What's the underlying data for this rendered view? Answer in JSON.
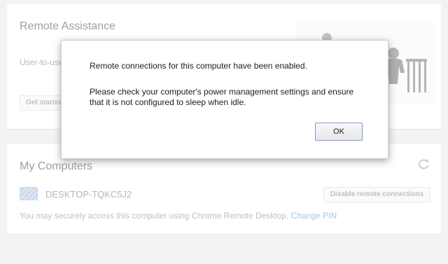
{
  "remote_assistance": {
    "title": "Remote Assistance",
    "description": "User-to-use",
    "get_started_label": "Get started"
  },
  "my_computers": {
    "title": "My Computers",
    "computer_name": "DESKTOP-TQKC5J2",
    "disable_label": "Disable remote connections",
    "description": "You may securely access this computer using Chrome Remote Desktop.",
    "change_pin_label": "Change PIN"
  },
  "dialog": {
    "line1": "Remote connections for this computer have been enabled.",
    "line2": "Please check your computer's power management settings and ensure that it is not configured to sleep when idle.",
    "ok_label": "OK"
  },
  "icons": {
    "refresh": "refresh-icon",
    "computer": "computer-icon",
    "illustration": "person-at-desk-illustration"
  },
  "colors": {
    "link": "#a8c2ea",
    "ok_border": "#7a9ad2"
  }
}
